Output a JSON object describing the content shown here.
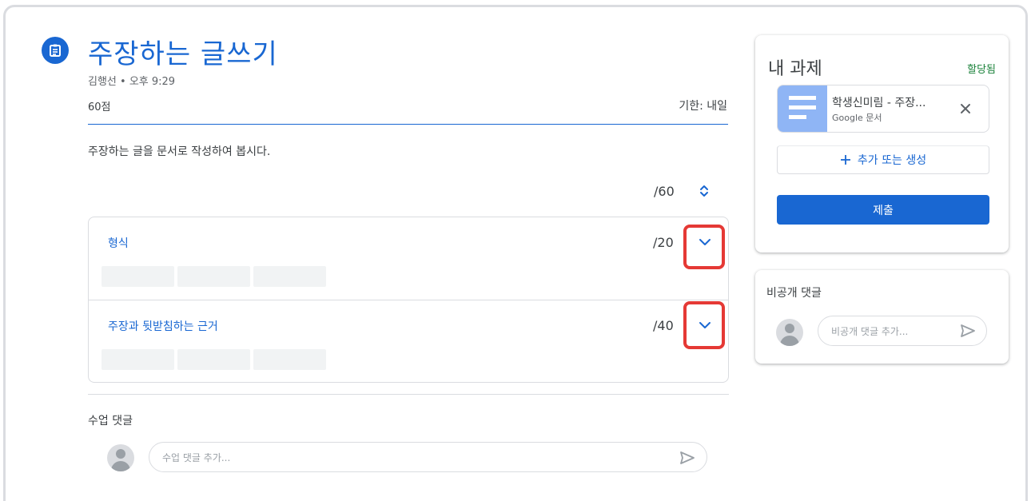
{
  "assignment": {
    "title": "주장하는 글쓰기",
    "byline": "김행선 • 오후 9:29",
    "points": "60점",
    "due": "기한: 내일",
    "instructions": "주장하는 글을 문서로 작성하여 봅시다.",
    "icon": "assignment-icon"
  },
  "rubric": {
    "total": "/60",
    "criteria": [
      {
        "name": "형식",
        "score": "/20"
      },
      {
        "name": "주장과 뒷받침하는 근거",
        "score": "/40"
      }
    ]
  },
  "class_comments": {
    "label": "수업 댓글",
    "placeholder": "수업 댓글 추가..."
  },
  "your_work": {
    "heading": "내 과제",
    "status": "할당됨",
    "attachment": {
      "title": "학생신미림 - 주장...",
      "type": "Google 문서"
    },
    "add_create": "추가 또는 생성",
    "submit": "제출"
  },
  "private_comments": {
    "heading": "비공개 댓글",
    "placeholder": "비공개 댓글 추가..."
  },
  "colors": {
    "accent": "#1967d2",
    "status_green": "#188038",
    "highlight_red": "#e53935"
  }
}
